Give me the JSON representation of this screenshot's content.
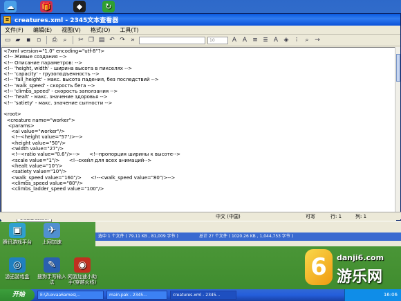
{
  "desktop_icons_top": [
    {
      "label": "",
      "glyph": "☁",
      "color": "#4aa0e8"
    },
    {
      "label": "",
      "glyph": "🎁",
      "color": "#d03050"
    },
    {
      "label": "",
      "glyph": "◆",
      "color": "#202020"
    },
    {
      "label": "",
      "glyph": "↻",
      "color": "#30a030"
    }
  ],
  "desktop_icons_bottom": [
    {
      "label": "腾讯游戏平台",
      "glyph": "▣",
      "color": "#30a0d0"
    },
    {
      "label": "上网加速",
      "glyph": "✈",
      "color": "#5090d0"
    },
    {
      "label": "游迅游戏盒",
      "glyph": "◎",
      "color": "#2080c0"
    },
    {
      "label": "搜狗手写输入法",
      "glyph": "✎",
      "color": "#2a60b0"
    },
    {
      "label": "网游加速小助手(穿越火线)",
      "glyph": "◉",
      "color": "#c03020"
    }
  ],
  "window": {
    "title": "creatures.xml - 2345文本查看器",
    "menu": [
      "文件(F)",
      "编辑(E)",
      "视图(V)",
      "格式(O)",
      "工具(T)"
    ],
    "toolbar_font_size": "10",
    "content_lines": [
      "<?xml version=\"1.0\" encoding=\"utf-8\"?>",
      "<!-- Живые создания -->",
      "<!-- Описание параметров: -->",
      "<!-- 'height, width' - ширина высота в пикселях -->",
      "<!-- 'capacity' - грузоподъемность -->",
      "<!-- 'fall_height' - макс. высота падения, без последствий -->",
      "<!-- 'walk_speed' - скорость бега -->",
      "<!-- 'climbs_speed' - скорость заползания -->",
      "<!-- 'healt' - макс. значение здоровья -->",
      "<!-- 'satiety' - макс. значение сытности -->",
      "",
      "<root>",
      "  <creature name=\"worker\">",
      "   <params>",
      "     <ai value=\"worker\"/>",
      "     <!--<height value=\"57\"/>-->",
      "     <height value=\"50\"/>",
      "     <width value=\"27\"/>",
      "     <!--<ratio value=\"0.6\"/>-->      <!--пропорция ширины к высоте-->",
      "     <scale value=\"1\"/>      <!--скейл для всех анимаций-->",
      "     <healt value=\"10\"/>",
      "     <satiety value=\"10\"/>",
      "     <walk_speed value=\"160\"/>      <!--<walk_speed value=\"80\"/>-->",
      "     <climbs_speed value=\"80\"/>",
      "     <climbs_ladder_speed value=\"100\"/>"
    ],
    "tab_label": "creatures.xml",
    "status": {
      "encoding": "中文 (中国)",
      "mode": "可写",
      "line": "行: 1",
      "col": "列: 1"
    }
  },
  "explorer_status": {
    "selected": "选中 1 个文件 ( 79.11 KB , 81,009 字节 )",
    "total": "总计 2? 个文件 ( 1020.26 KB , 1,044,753 字节 )"
  },
  "taskbar": {
    "start_label": "开始",
    "tasks": [
      "E:\\Zuxvaa6ames\\...",
      "main.pak - 2345...",
      "creatures.xml - 2345..."
    ],
    "clock": "16:06"
  },
  "watermark": {
    "site": "danji6.com",
    "brand": "游乐网",
    "logo_glyph": "6"
  }
}
